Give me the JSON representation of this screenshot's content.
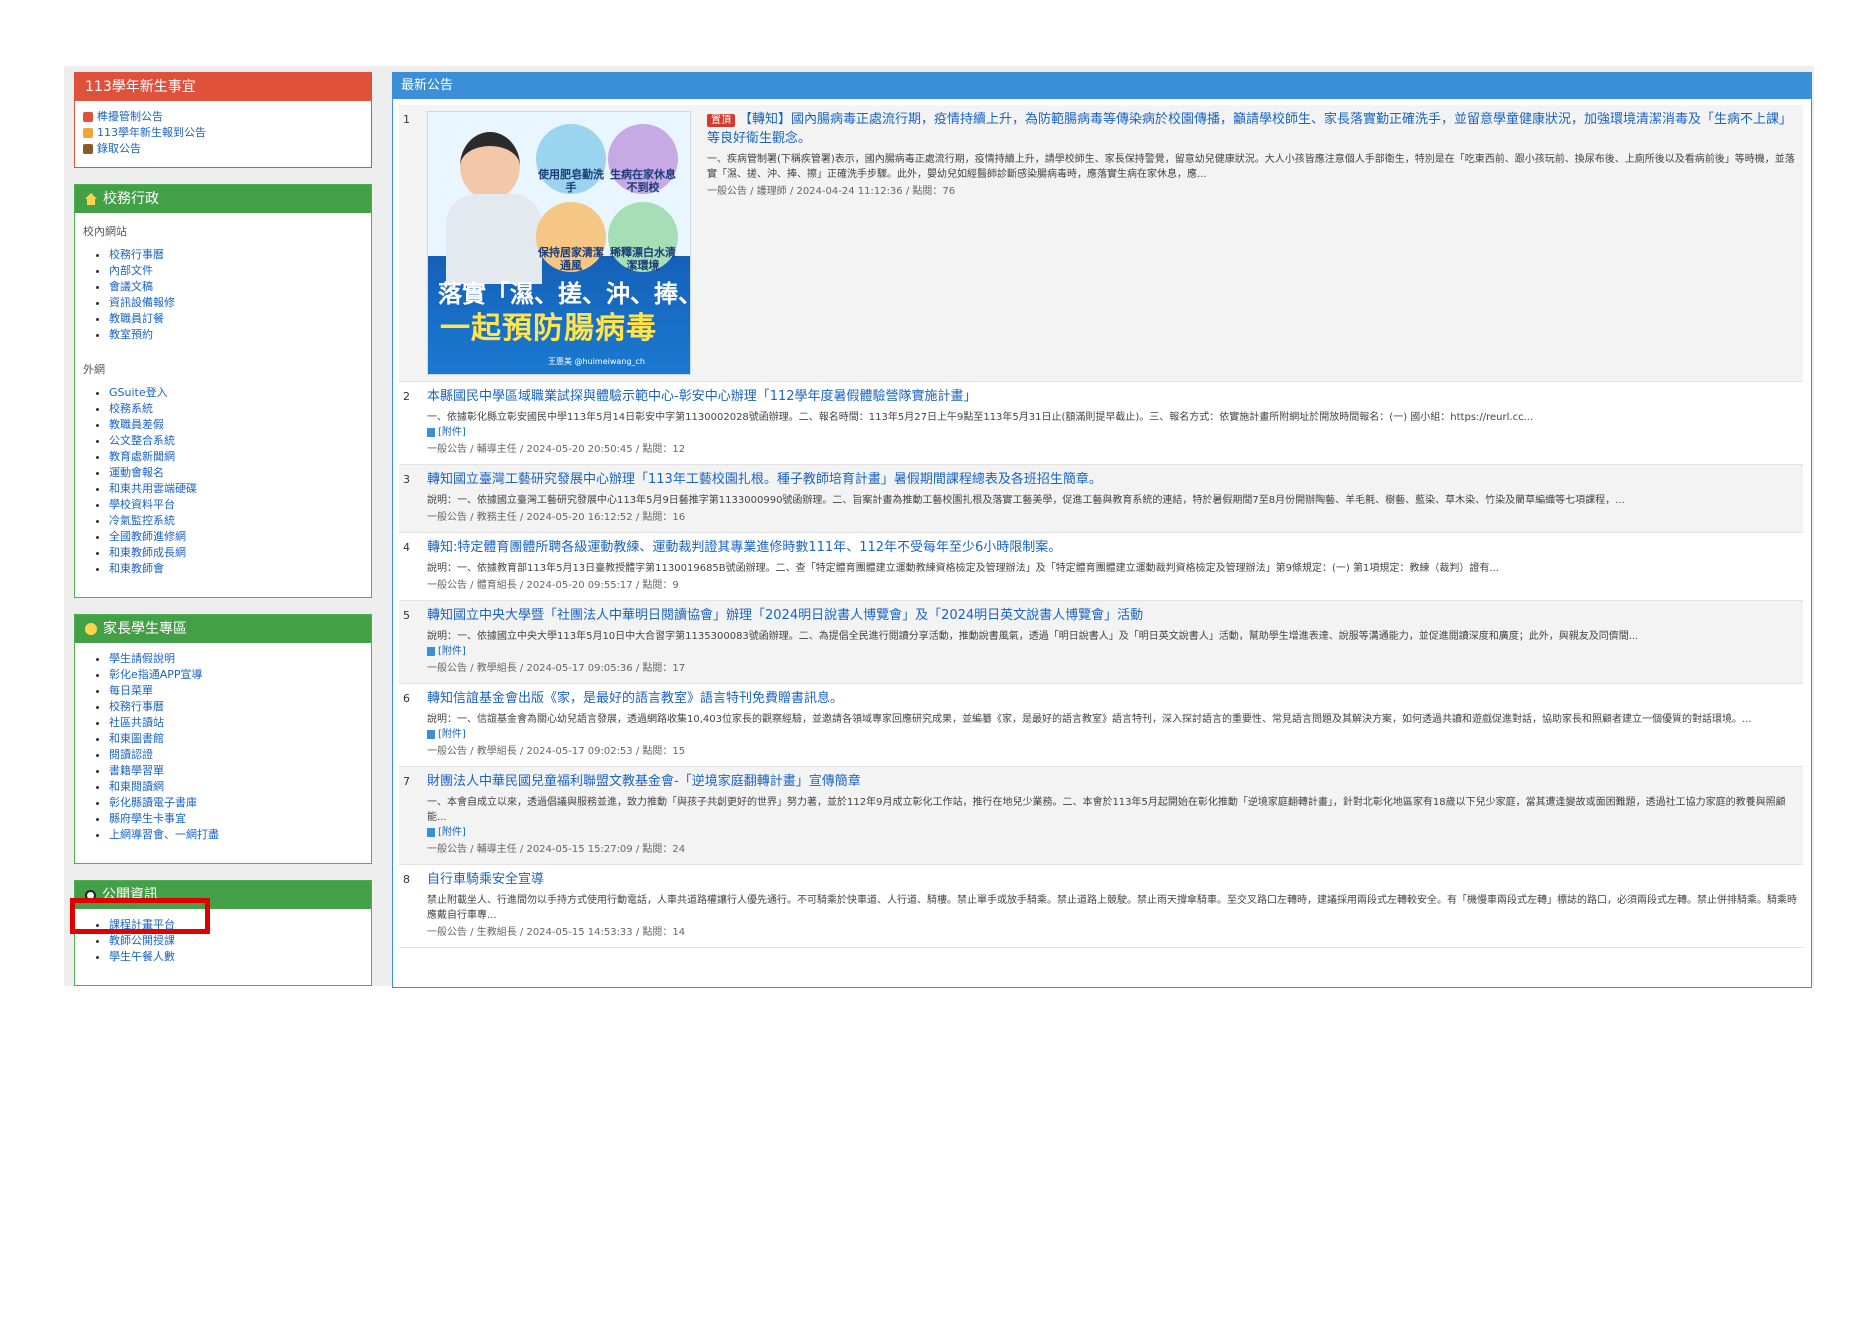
{
  "sidebar": {
    "newstudent": {
      "title": "113學年新生事宜",
      "items": [
        "榫擾管制公告",
        "113學年新生報到公告",
        "錄取公告"
      ]
    },
    "admin": {
      "title": "校務行政",
      "internal_label": "校內網站",
      "internal": [
        "校務行事曆",
        "內部文件",
        "會議文稿",
        "資訊設備報修",
        "教職員訂餐",
        "教室預約"
      ],
      "external_label": "外網",
      "external": [
        "GSuite登入",
        "校務系統",
        "教職員差假",
        "公文整合系統",
        "教育處新聞網",
        "運動會報名",
        "和東共用雲端硬碟",
        "學校資料平台",
        "冷氣監控系統",
        "全國教師進修網",
        "和東教師成長網",
        "和東教師會"
      ]
    },
    "parents": {
      "title": "家長學生專區",
      "items": [
        "學生請假說明",
        "彰化e指通APP宣導",
        "每日菜單",
        "校務行事曆",
        "社區共讀站",
        "和東圖書館",
        "閱讀認證",
        "書籍學習單",
        "和東閱讀網",
        "彰化縣讀電子書庫",
        "縣府學生卡事宜",
        "上網導習會、一網打盡"
      ]
    },
    "public": {
      "title": "公開資訊",
      "items": [
        "課程計畫平台",
        "教師公開授課",
        "學生午餐人數"
      ]
    }
  },
  "main": {
    "header": "最新公告",
    "poster": {
      "circle_labels": [
        "使用肥皂勤洗手",
        "生病在家休息不到校",
        "保持居家清潔通風",
        "稀釋漂白水清潔環境"
      ],
      "line1": "落實「濕、搓、沖、捧、擦」",
      "line2": "一起預防腸病毒",
      "credit": "王惠美 @huimeiwang_ch"
    },
    "items": [
      {
        "num": "1",
        "badge": "置頂",
        "title": "【轉知】國內腸病毒正處流行期，疫情持續上升，為防範腸病毒等傳染病於校園傳播，籲請學校師生、家長落實勤正確洗手，並留意學童健康狀況，加強環境清潔消毒及「生病不上課」等良好衛生觀念。",
        "desc": "一、疾病管制署(下稱疾管署)表示，國內腸病毒正處流行期，疫情持續上升，請學校師生、家長保持警覺，留意幼兒健康狀況。大人小孩皆應注意個人手部衛生，特別是在「吃東西前、跟小孩玩前、換尿布後、上廁所後以及看病前後」等時機，並落實「濕、搓、沖、捧、擦」正確洗手步驟。此外，嬰幼兒如經醫師診斷感染腸病毒時，應落實生病在家休息，應...",
        "attachment": "",
        "meta": "一般公告 / 護理師 / 2024-04-24 11:12:36 / 點閱：76"
      },
      {
        "num": "2",
        "title": "本縣國民中學區域職業試探與體驗示範中心-彰安中心辦理「112學年度暑假體驗營隊實施計畫」",
        "desc": "一、依據彰化縣立彰安國民中學113年5月14日彰安中字第1130002028號函辦理。二、報名時間：113年5月27日上午9點至113年5月31日止(額滿則提早截止)。三、報名方式：依實施計畫所附網址於開放時間報名：(一) 國小組：https://reurl.cc...",
        "attachment": "[附件]",
        "meta": "一般公告 / 輔導主任 / 2024-05-20 20:50:45 / 點閱：12"
      },
      {
        "num": "3",
        "title": "轉知國立臺灣工藝研究發展中心辦理「113年工藝校園扎根。種子教師培育計畫」暑假期間課程總表及各班招生簡章。",
        "desc": "說明：一、依據國立臺灣工藝研究發展中心113年5月9日藝推字第1133000990號函辦理。二、旨案計畫為推動工藝校園扎根及落實工藝美學，促進工藝與教育系統的連結，特於暑假期間7至8月份開辦陶藝、羊毛氈、樹藝、藍染、草木染、竹染及藺草編織等七項課程，...",
        "attachment": "",
        "meta": "一般公告 / 教務主任 / 2024-05-20 16:12:52 / 點閱：16"
      },
      {
        "num": "4",
        "title": "轉知:特定體育團體所聘各級運動教練、運動裁判證其專業進修時數111年、112年不受每年至少6小時限制案。",
        "desc": "說明：一、依據教育部113年5月13日臺教授體字第1130019685B號函辦理。二、查「特定體育團體建立運動教練資格檢定及管理辦法」及「特定體育團體建立運動裁判資格檢定及管理辦法」第9條規定：(一) 第1項規定：教練（裁判）證有...",
        "attachment": "",
        "meta": "一般公告 / 體育組長 / 2024-05-20 09:55:17 / 點閱：9"
      },
      {
        "num": "5",
        "title": "轉知國立中央大學暨「社團法人中華明日閱讀協會」辦理「2024明日說書人博覽會」及「2024明日英文說書人博覽會」活動",
        "desc": "說明：一、依據國立中央大學113年5月10日中大合習字第1135300083號函辦理。二、為提倡全民進行閱讀分享活動，推動說書風氣，透過「明日說書人」及「明日英文說書人」活動，幫助學生增進表達、說服等溝通能力，並促進閱讀深度和廣度；此外，與親友及同儕間...",
        "attachment": "[附件]",
        "meta": "一般公告 / 教學組長 / 2024-05-17 09:05:36 / 點閱：17"
      },
      {
        "num": "6",
        "title": "轉知信誼基金會出版《家，是最好的語言教室》語言特刊免費贈書訊息。",
        "desc": "說明：一、信誼基金會為關心幼兒語言發展，透過網路收集10,403位家長的觀察經驗，並邀請各領域專家回應研究成果，並編纂《家，是最好的語言教室》語言特刊，深入探討語言的重要性、常見語言問題及其解決方案，如何透過共讀和遊戲促進對話，協助家長和照顧者建立一個優質的對話環境。...",
        "attachment": "[附件]",
        "meta": "一般公告 / 教學組長 / 2024-05-17 09:02:53 / 點閱：15"
      },
      {
        "num": "7",
        "title": "財團法人中華民國兒童福利聯盟文教基金會-「逆境家庭翻轉計畫」宣傳簡章",
        "desc": "一、本會自成立以來，透過倡議與服務並進，致力推動「與孩子共創更好的世界」努力著，並於112年9月成立彰化工作站，推行在地兒少業務。二、本會於113年5月起開始在彰化推動「逆境家庭翻轉計畫」，針對北彰化地區家有18歲以下兒少家庭，當其遭逢變故或面困難題，透過社工協力家庭的教養與照顧能...",
        "attachment": "[附件]",
        "meta": "一般公告 / 輔導主任 / 2024-05-15 15:27:09 / 點閱：24"
      },
      {
        "num": "8",
        "title": "自行車騎乘安全宣導",
        "desc": "禁止附載坐人、行進間勿以手持方式使用行動電話，人車共道路權讓行人優先通行。不可騎乘於快車道、人行道、騎樓。禁止單手或放手騎乘。禁止道路上競駛。禁止雨天撐傘騎車。至交叉路口左轉時，建議採用兩段式左轉較安全。有「機慢車兩段式左轉」標誌的路口，必須兩段式左轉。禁止併排騎乘。騎乘時應戴自行車專...",
        "attachment": "",
        "meta": "一般公告 / 生教組長 / 2024-05-15 14:53:33 / 點閱：14"
      }
    ]
  },
  "colors": {
    "red_header": "#e0513c",
    "green_header": "#43a047",
    "blue_header": "#3a8fd8",
    "link": "#1a64c4",
    "highlight": "#e00000"
  }
}
